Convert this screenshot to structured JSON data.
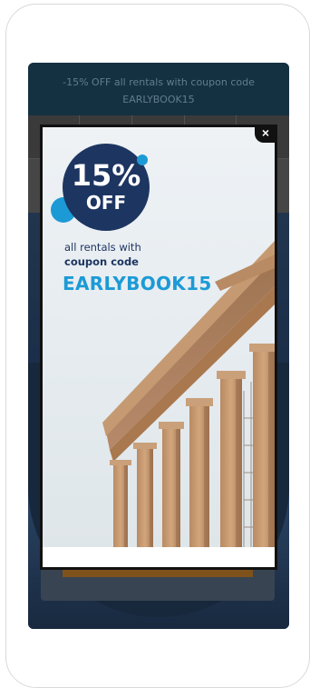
{
  "promo_bar": {
    "line1": "-15% OFF all rentals with coupon code",
    "line2": "EARLYBOOK15"
  },
  "popup": {
    "close_label": "×",
    "badge_percent": "15%",
    "badge_off": "OFF",
    "copy_line1": "all rentals with",
    "copy_line2": "coupon code",
    "coupon_code": "EARLYBOOK15",
    "image_icon": "parthenon-photo",
    "colors": {
      "badge_navy": "#1d3561",
      "accent_blue": "#1c9ad6",
      "promo_bar_bg": "#163648"
    }
  }
}
